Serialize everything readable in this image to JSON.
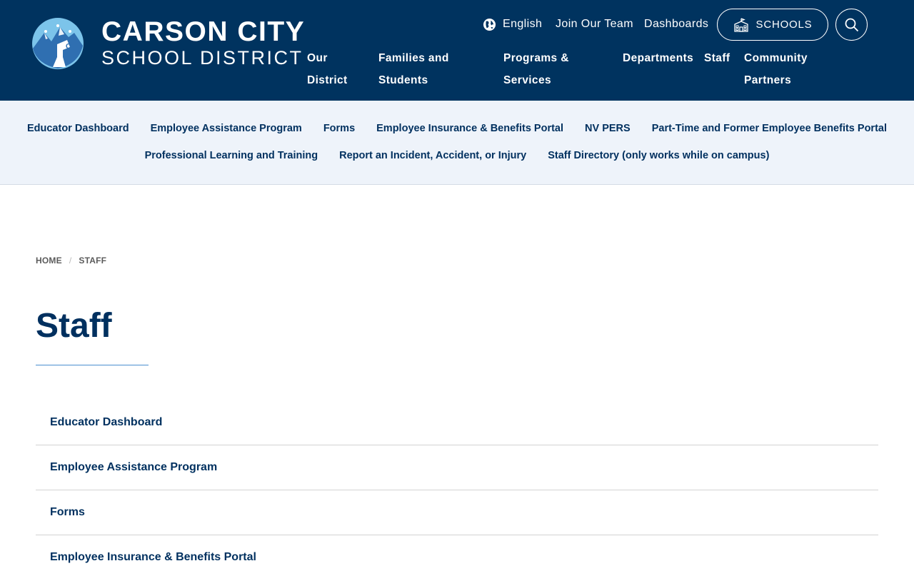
{
  "brand": {
    "line1": "CARSON CITY",
    "line2": "SCHOOL DISTRICT",
    "colors": {
      "primary": "#00335f",
      "subnav_bg": "#eef3fa",
      "accent_rule": "#4a8fd0"
    }
  },
  "utility": {
    "language": "English",
    "join": "Join Our Team",
    "dashboards": "Dashboards",
    "schools": "SCHOOLS",
    "search_icon": "search-icon"
  },
  "main_nav": {
    "our_district": "Our District",
    "families": "Families and Students",
    "programs": "Programs & Services",
    "departments": "Departments",
    "staff": "Staff",
    "community": "Community Partners"
  },
  "subnav": {
    "row1": [
      "Educator Dashboard",
      "Employee Assistance Program",
      "Forms",
      "Employee Insurance & Benefits Portal",
      "NV PERS",
      "Part-Time and Former Employee Benefits Portal"
    ],
    "row2": [
      "Professional Learning and Training",
      "Report an Incident, Accident, or Injury",
      "Staff Directory (only works while on campus)"
    ]
  },
  "breadcrumb": {
    "home": "HOME",
    "current": "STAFF"
  },
  "page": {
    "title": "Staff"
  },
  "links": [
    "Educator Dashboard",
    "Employee Assistance Program",
    "Forms",
    "Employee Insurance & Benefits Portal"
  ]
}
